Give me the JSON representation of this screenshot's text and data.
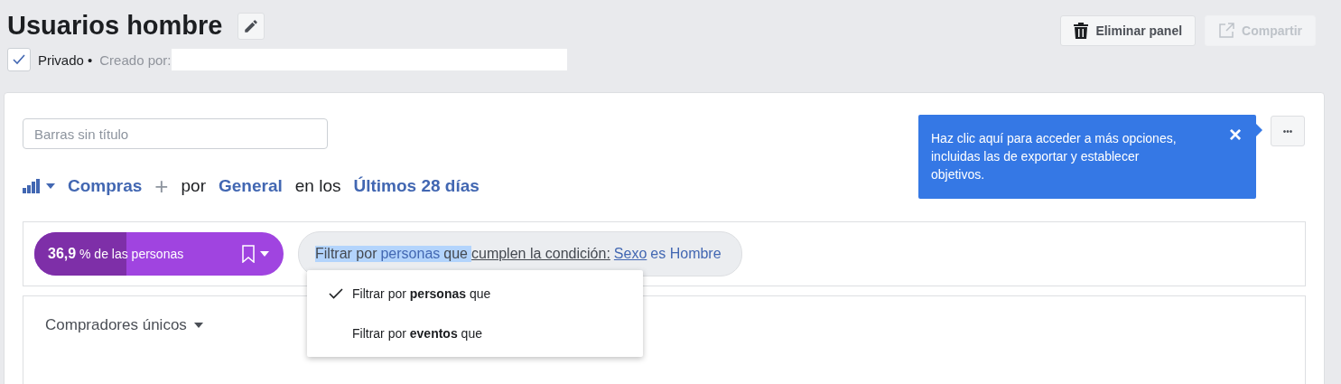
{
  "header": {
    "title": "Usuarios hombre",
    "private_checked": true,
    "private_label": "Privado •",
    "created_by": "Creado por:"
  },
  "actions": [
    {
      "label": "Eliminar panel",
      "disabled": false,
      "kind": "delete"
    },
    {
      "label": "Compartir",
      "disabled": true,
      "kind": "share"
    }
  ],
  "panel": {
    "title_field": {
      "placeholder": "Barras sin título"
    },
    "query": [
      {
        "kind": "link",
        "text": "Compras"
      },
      {
        "kind": "add",
        "text": "+"
      },
      {
        "kind": "plain",
        "text": "por"
      },
      {
        "kind": "link",
        "text": "General"
      },
      {
        "kind": "plain",
        "text": "en los"
      },
      {
        "kind": "link",
        "text": "Últimos 28 días"
      }
    ],
    "tooltip": {
      "text": "Haz clic aquí para acceder a más opciones, incluidas las de exportar y establecer objetivos.",
      "close": "×"
    },
    "more": "•••",
    "metric": {
      "value": "36,9",
      "unit": "% de las personas",
      "level": 0.369
    },
    "filter": [
      {
        "kind": "selected",
        "text": "Filtrar por"
      },
      {
        "kind": "selected-link",
        "text": "personas"
      },
      {
        "kind": "selected",
        "text": "que"
      },
      {
        "kind": "underlined",
        "text": "cumplen la condición:"
      },
      {
        "kind": "link-underlined",
        "text": "Sexo"
      },
      {
        "kind": "link",
        "text": "es Hombre"
      }
    ],
    "menu": [
      {
        "label": "Filtrar por **personas** que",
        "selected": true
      },
      {
        "label": "Filtrar por **eventos** que",
        "selected": false
      }
    ],
    "chart_selector": "Compradores únicos"
  }
}
